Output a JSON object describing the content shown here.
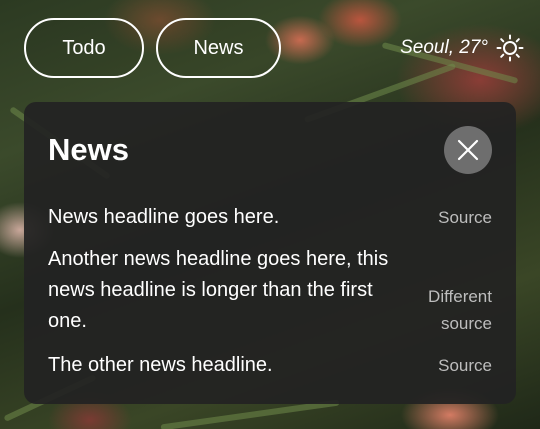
{
  "nav": {
    "todo_label": "Todo",
    "news_label": "News"
  },
  "weather": {
    "text": "Seoul, 27°",
    "icon": "sun-icon"
  },
  "panel": {
    "title": "News",
    "close_icon": "close-icon",
    "items": [
      {
        "headline": "News headline goes here.",
        "source": "Source"
      },
      {
        "headline": "Another news headline goes here, this news headline is longer than the first one.",
        "source": "Different source"
      },
      {
        "headline": "The other news headline.",
        "source": "Source"
      }
    ]
  },
  "colors": {
    "panel_bg": "#222222",
    "close_button_bg": "#6e6e6e",
    "source_text": "#bdbdbd",
    "text": "#ffffff"
  }
}
